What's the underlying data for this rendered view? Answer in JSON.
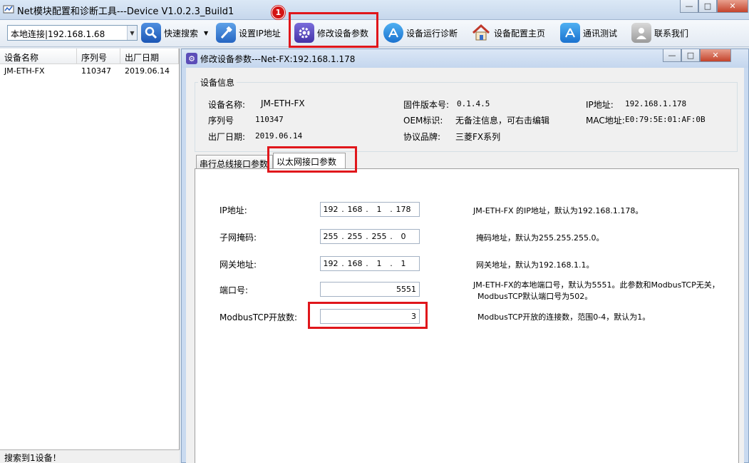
{
  "main_window": {
    "title": "Net模块配置和诊断工具---Device V1.0.2.3_Build1",
    "controls": {
      "minimize": "—",
      "maximize": "□",
      "close": "✕"
    }
  },
  "toolbar": {
    "connection": "本地连接|192.168.1.68",
    "buttons": [
      {
        "label": "快速搜索",
        "icon": "search-icon"
      },
      {
        "label": "设置IP地址",
        "icon": "hammer-icon"
      },
      {
        "label": "修改设备参数",
        "icon": "gear-icon"
      },
      {
        "label": "设备运行诊断",
        "icon": "app-store-icon"
      },
      {
        "label": "设备配置主页",
        "icon": "home-icon"
      },
      {
        "label": "通讯测试",
        "icon": "app-store-icon"
      },
      {
        "label": "联系我们",
        "icon": "contact-icon"
      }
    ],
    "step_badge": "1",
    "accent_color": "#e0161b"
  },
  "device_list": {
    "columns": [
      "设备名称",
      "序列号",
      "出厂日期"
    ],
    "rows": [
      [
        "JM-ETH-FX",
        "110347",
        "2019.06.14"
      ]
    ]
  },
  "status_bar": "搜索到1设备！",
  "dialog": {
    "title": "修改设备参数---Net-FX:192.168.1.178",
    "controls": {
      "minimize": "—",
      "maximize": "□",
      "close": "✕"
    },
    "device_info": {
      "legend": "设备信息",
      "name_label": "设备名称:",
      "name": "JM-ETH-FX",
      "serial_label": "序列号",
      "serial": "110347",
      "date_label": "出厂日期:",
      "date": "2019.06.14",
      "firmware_label": "固件版本号:",
      "firmware": "0.1.4.5",
      "oem_label": "OEM标识:",
      "oem": "无备注信息，可右击编辑",
      "protocol_label": "协议品牌:",
      "protocol": "三菱FX系列",
      "ip_label": "IP地址:",
      "ip": "192.168.1.178",
      "mac_label": "MAC地址:",
      "mac": "E0:79:5E:01:AF:0B"
    },
    "tabs": [
      "串行总线接口参数",
      "以太网接口参数"
    ],
    "active_tab": 1,
    "ethernet": {
      "ip": {
        "label": "IP地址:",
        "octets": [
          "192",
          "168",
          "1",
          "178"
        ],
        "desc": "JM-ETH-FX 的IP地址，默认为192.168.1.178。"
      },
      "subnet": {
        "label": "子网掩码:",
        "octets": [
          "255",
          "255",
          "255",
          "0"
        ],
        "desc": "掩码地址，默认为255.255.255.0。"
      },
      "gateway": {
        "label": "网关地址:",
        "octets": [
          "192",
          "168",
          "1",
          "1"
        ],
        "desc": "网关地址，默认为192.168.1.1。"
      },
      "port": {
        "label": "端口号:",
        "value": "5551",
        "desc_line1": "JM-ETH-FX的本地端口号，默认为5551。此参数和ModbusTCP无关，",
        "desc_line2": "ModbusTCP默认端口号为502。"
      },
      "modbus": {
        "label": "ModbusTCP开放数:",
        "value": "3",
        "desc": "ModbusTCP开放的连接数，范围0-4，默认为1。"
      }
    }
  }
}
